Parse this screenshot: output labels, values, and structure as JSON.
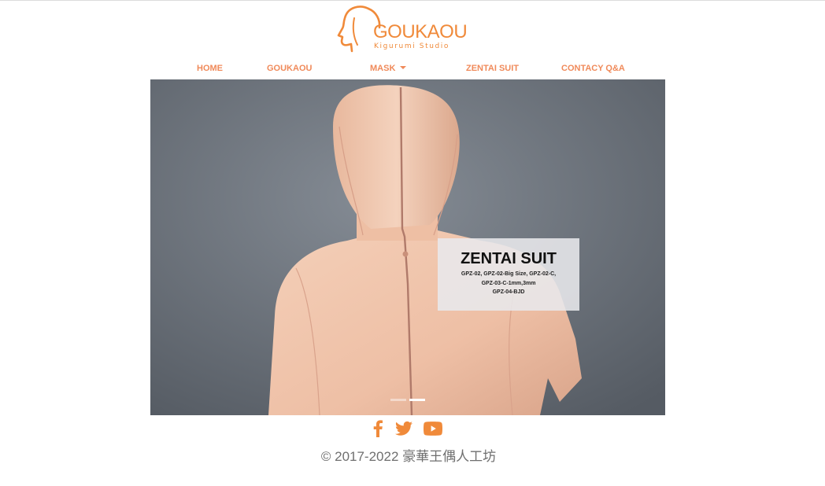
{
  "brand": {
    "name": "GOUKAOU",
    "tagline": "Kigurumi Studio",
    "color": "#f08a3a"
  },
  "nav": {
    "items": [
      {
        "label": "HOME"
      },
      {
        "label": "GOUKAOU"
      },
      {
        "label": "MASK",
        "has_dropdown": true
      },
      {
        "label": "ZENTAI SUIT"
      },
      {
        "label": "CONTACY Q&A"
      }
    ],
    "color": "#f08a5a"
  },
  "carousel": {
    "caption": {
      "title": "ZENTAI SUIT",
      "lines": [
        "GPZ-02, GPZ-02-Big Size, GPZ-02-C,",
        "GPZ-03-C-1mm,3mm",
        "GPZ-04-BJD"
      ]
    },
    "slide_count": 2,
    "active_index": 1
  },
  "social": {
    "icons": [
      "facebook-icon",
      "twitter-icon",
      "youtube-icon"
    ],
    "color": "#f08a3a"
  },
  "footer": {
    "copyright": "© 2017-2022 豪華王偶人工坊"
  }
}
